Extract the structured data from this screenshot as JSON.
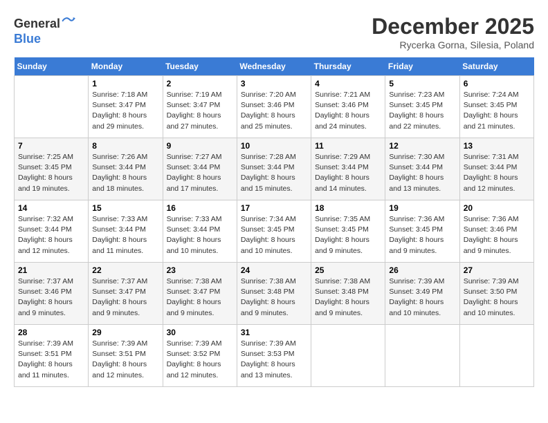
{
  "header": {
    "logo_line1": "General",
    "logo_line2": "Blue",
    "month_title": "December 2025",
    "subtitle": "Rycerka Gorna, Silesia, Poland"
  },
  "days_of_week": [
    "Sunday",
    "Monday",
    "Tuesday",
    "Wednesday",
    "Thursday",
    "Friday",
    "Saturday"
  ],
  "weeks": [
    [
      {
        "day": "",
        "empty": true
      },
      {
        "day": "1",
        "sunrise": "Sunrise: 7:18 AM",
        "sunset": "Sunset: 3:47 PM",
        "daylight": "Daylight: 8 hours and 29 minutes."
      },
      {
        "day": "2",
        "sunrise": "Sunrise: 7:19 AM",
        "sunset": "Sunset: 3:47 PM",
        "daylight": "Daylight: 8 hours and 27 minutes."
      },
      {
        "day": "3",
        "sunrise": "Sunrise: 7:20 AM",
        "sunset": "Sunset: 3:46 PM",
        "daylight": "Daylight: 8 hours and 25 minutes."
      },
      {
        "day": "4",
        "sunrise": "Sunrise: 7:21 AM",
        "sunset": "Sunset: 3:46 PM",
        "daylight": "Daylight: 8 hours and 24 minutes."
      },
      {
        "day": "5",
        "sunrise": "Sunrise: 7:23 AM",
        "sunset": "Sunset: 3:45 PM",
        "daylight": "Daylight: 8 hours and 22 minutes."
      },
      {
        "day": "6",
        "sunrise": "Sunrise: 7:24 AM",
        "sunset": "Sunset: 3:45 PM",
        "daylight": "Daylight: 8 hours and 21 minutes."
      }
    ],
    [
      {
        "day": "7",
        "sunrise": "Sunrise: 7:25 AM",
        "sunset": "Sunset: 3:45 PM",
        "daylight": "Daylight: 8 hours and 19 minutes."
      },
      {
        "day": "8",
        "sunrise": "Sunrise: 7:26 AM",
        "sunset": "Sunset: 3:44 PM",
        "daylight": "Daylight: 8 hours and 18 minutes."
      },
      {
        "day": "9",
        "sunrise": "Sunrise: 7:27 AM",
        "sunset": "Sunset: 3:44 PM",
        "daylight": "Daylight: 8 hours and 17 minutes."
      },
      {
        "day": "10",
        "sunrise": "Sunrise: 7:28 AM",
        "sunset": "Sunset: 3:44 PM",
        "daylight": "Daylight: 8 hours and 15 minutes."
      },
      {
        "day": "11",
        "sunrise": "Sunrise: 7:29 AM",
        "sunset": "Sunset: 3:44 PM",
        "daylight": "Daylight: 8 hours and 14 minutes."
      },
      {
        "day": "12",
        "sunrise": "Sunrise: 7:30 AM",
        "sunset": "Sunset: 3:44 PM",
        "daylight": "Daylight: 8 hours and 13 minutes."
      },
      {
        "day": "13",
        "sunrise": "Sunrise: 7:31 AM",
        "sunset": "Sunset: 3:44 PM",
        "daylight": "Daylight: 8 hours and 12 minutes."
      }
    ],
    [
      {
        "day": "14",
        "sunrise": "Sunrise: 7:32 AM",
        "sunset": "Sunset: 3:44 PM",
        "daylight": "Daylight: 8 hours and 12 minutes."
      },
      {
        "day": "15",
        "sunrise": "Sunrise: 7:33 AM",
        "sunset": "Sunset: 3:44 PM",
        "daylight": "Daylight: 8 hours and 11 minutes."
      },
      {
        "day": "16",
        "sunrise": "Sunrise: 7:33 AM",
        "sunset": "Sunset: 3:44 PM",
        "daylight": "Daylight: 8 hours and 10 minutes."
      },
      {
        "day": "17",
        "sunrise": "Sunrise: 7:34 AM",
        "sunset": "Sunset: 3:45 PM",
        "daylight": "Daylight: 8 hours and 10 minutes."
      },
      {
        "day": "18",
        "sunrise": "Sunrise: 7:35 AM",
        "sunset": "Sunset: 3:45 PM",
        "daylight": "Daylight: 8 hours and 9 minutes."
      },
      {
        "day": "19",
        "sunrise": "Sunrise: 7:36 AM",
        "sunset": "Sunset: 3:45 PM",
        "daylight": "Daylight: 8 hours and 9 minutes."
      },
      {
        "day": "20",
        "sunrise": "Sunrise: 7:36 AM",
        "sunset": "Sunset: 3:46 PM",
        "daylight": "Daylight: 8 hours and 9 minutes."
      }
    ],
    [
      {
        "day": "21",
        "sunrise": "Sunrise: 7:37 AM",
        "sunset": "Sunset: 3:46 PM",
        "daylight": "Daylight: 8 hours and 9 minutes."
      },
      {
        "day": "22",
        "sunrise": "Sunrise: 7:37 AM",
        "sunset": "Sunset: 3:47 PM",
        "daylight": "Daylight: 8 hours and 9 minutes."
      },
      {
        "day": "23",
        "sunrise": "Sunrise: 7:38 AM",
        "sunset": "Sunset: 3:47 PM",
        "daylight": "Daylight: 8 hours and 9 minutes."
      },
      {
        "day": "24",
        "sunrise": "Sunrise: 7:38 AM",
        "sunset": "Sunset: 3:48 PM",
        "daylight": "Daylight: 8 hours and 9 minutes."
      },
      {
        "day": "25",
        "sunrise": "Sunrise: 7:38 AM",
        "sunset": "Sunset: 3:48 PM",
        "daylight": "Daylight: 8 hours and 9 minutes."
      },
      {
        "day": "26",
        "sunrise": "Sunrise: 7:39 AM",
        "sunset": "Sunset: 3:49 PM",
        "daylight": "Daylight: 8 hours and 10 minutes."
      },
      {
        "day": "27",
        "sunrise": "Sunrise: 7:39 AM",
        "sunset": "Sunset: 3:50 PM",
        "daylight": "Daylight: 8 hours and 10 minutes."
      }
    ],
    [
      {
        "day": "28",
        "sunrise": "Sunrise: 7:39 AM",
        "sunset": "Sunset: 3:51 PM",
        "daylight": "Daylight: 8 hours and 11 minutes."
      },
      {
        "day": "29",
        "sunrise": "Sunrise: 7:39 AM",
        "sunset": "Sunset: 3:51 PM",
        "daylight": "Daylight: 8 hours and 12 minutes."
      },
      {
        "day": "30",
        "sunrise": "Sunrise: 7:39 AM",
        "sunset": "Sunset: 3:52 PM",
        "daylight": "Daylight: 8 hours and 12 minutes."
      },
      {
        "day": "31",
        "sunrise": "Sunrise: 7:39 AM",
        "sunset": "Sunset: 3:53 PM",
        "daylight": "Daylight: 8 hours and 13 minutes."
      },
      {
        "day": "",
        "empty": true
      },
      {
        "day": "",
        "empty": true
      },
      {
        "day": "",
        "empty": true
      }
    ]
  ]
}
